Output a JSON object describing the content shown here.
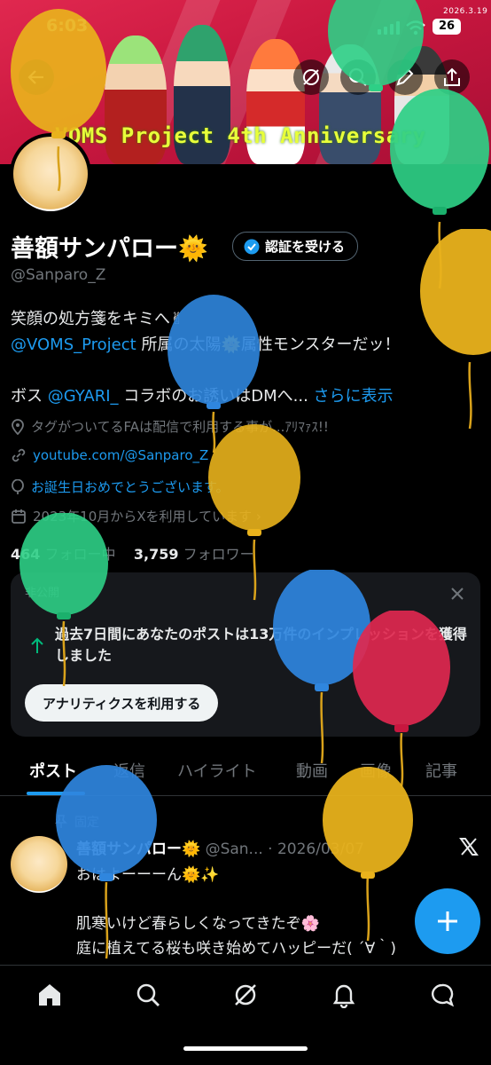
{
  "status_bar": {
    "time": "6:03",
    "battery": "26",
    "date_stamp": "2026.3.19"
  },
  "banner": {
    "title": "VOMS Project 4th Anniversary"
  },
  "profile": {
    "name": "善額サンパロー",
    "name_emoji": "🌞",
    "verify_label": "認証を受ける",
    "handle": "@Sanparo_Z",
    "bio_line1": "笑顔の処方箋をキミへ✌",
    "bio_line2_link": "@VOMS_Project",
    "bio_line2_rest": " 所属の太陽🌞属性モンスターだッ！",
    "bio_line3_a": "ボス ",
    "bio_line3_link": "@GYARI_",
    "bio_line3_b": " コラボのお誘いはDMへ...",
    "show_more": "さらに表示",
    "location": "タグがついてるFAは配信で利用する事が...ｱﾘﾏｧｽ!!",
    "website": "youtube.com/@Sanparo_Z",
    "birthday": "お誕生日おめでとうございます。",
    "joined": "2023年10月からXを利用しています ›",
    "following_count": "464",
    "following_label": "フォロー中",
    "followers_count": "3,759",
    "followers_label": "フォロワー"
  },
  "analytics_card": {
    "label": "非公開",
    "text": "過去7日間にあなたのポストは13万件のインプレッションを獲得しました",
    "button": "アナリティクスを利用する"
  },
  "tabs": [
    "ポスト",
    "返信",
    "ハイライト",
    "動画",
    "画像",
    "記事"
  ],
  "post": {
    "pinned": "固定",
    "author": "善額サンパロー🌞",
    "meta": "@San... · 2026/03/07",
    "line1": "おはよーーーん🌞✨",
    "line2": "肌寒いけど春らしくなってきたぞ🌸",
    "line3": "庭に植えてる桜も咲き始めてハッピーだ( ´∀｀)"
  },
  "colors": {
    "accent": "#1d9bf0",
    "banner": "#c9173f",
    "banner_text": "#e8ff3a"
  }
}
